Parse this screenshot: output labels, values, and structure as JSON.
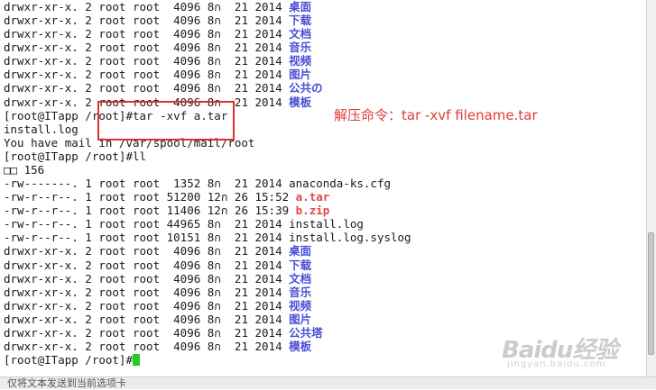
{
  "terminal": {
    "lines": [
      {
        "text": "drwxr-xr-x. 2 root root  4096 8ก  21 2014 ",
        "name": "桌面",
        "style": "dir"
      },
      {
        "text": "drwxr-xr-x. 2 root root  4096 8ก  21 2014 ",
        "name": "下载",
        "style": "dir"
      },
      {
        "text": "drwxr-xr-x. 2 root root  4096 8ก  21 2014 ",
        "name": "文档",
        "style": "dir"
      },
      {
        "text": "drwxr-xr-x. 2 root root  4096 8ก  21 2014 ",
        "name": "音乐",
        "style": "dir"
      },
      {
        "text": "drwxr-xr-x. 2 root root  4096 8ก  21 2014 ",
        "name": "视频",
        "style": "dir"
      },
      {
        "text": "drwxr-xr-x. 2 root root  4096 8ก  21 2014 ",
        "name": "图片",
        "style": "dir"
      },
      {
        "text": "drwxr-xr-x. 2 root root  4096 8ก  21 2014 ",
        "name": "公共の",
        "style": "dir"
      },
      {
        "text": "drwxr-xr-x. 2 root root  4096 8ก  21 2014 ",
        "name": "模板",
        "style": "dir"
      },
      {
        "text": "[root@ITapp /root]#tar -xvf a.tar",
        "name": "",
        "style": "plain"
      },
      {
        "text": "install.log",
        "name": "",
        "style": "plain"
      },
      {
        "text": "You have mail in /var/spool/mail/root",
        "name": "",
        "style": "plain"
      },
      {
        "text": "[root@ITapp /root]#ll",
        "name": "",
        "style": "plain"
      },
      {
        "text": "□□ 156",
        "name": "",
        "style": "plain"
      },
      {
        "text": "-rw-------. 1 root root  1352 8ก  21 2014 anaconda-ks.cfg",
        "name": "",
        "style": "plain"
      },
      {
        "text": "-rw-r--r--. 1 root root 51200 12ก 26 15:52 ",
        "name": "a.tar",
        "style": "red"
      },
      {
        "text": "-rw-r--r--. 1 root root 11406 12ก 26 15:39 ",
        "name": "b.zip",
        "style": "red"
      },
      {
        "text": "-rw-r--r--. 1 root root 44965 8ก  21 2014 install.log",
        "name": "",
        "style": "plain"
      },
      {
        "text": "-rw-r--r--. 1 root root 10151 8ก  21 2014 install.log.syslog",
        "name": "",
        "style": "plain"
      },
      {
        "text": "drwxr-xr-x. 2 root root  4096 8ก  21 2014 ",
        "name": "桌面",
        "style": "dir"
      },
      {
        "text": "drwxr-xr-x. 2 root root  4096 8ก  21 2014 ",
        "name": "下载",
        "style": "dir"
      },
      {
        "text": "drwxr-xr-x. 2 root root  4096 8ก  21 2014 ",
        "name": "文档",
        "style": "dir"
      },
      {
        "text": "drwxr-xr-x. 2 root root  4096 8ก  21 2014 ",
        "name": "音乐",
        "style": "dir"
      },
      {
        "text": "drwxr-xr-x. 2 root root  4096 8ก  21 2014 ",
        "name": "视频",
        "style": "dir"
      },
      {
        "text": "drwxr-xr-x. 2 root root  4096 8ก  21 2014 ",
        "name": "图片",
        "style": "dir"
      },
      {
        "text": "drwxr-xr-x. 2 root root  4096 8ก  21 2014 ",
        "name": "公共塔",
        "style": "dir"
      },
      {
        "text": "drwxr-xr-x. 2 root root  4096 8ก  21 2014 ",
        "name": "模板",
        "style": "dir"
      },
      {
        "text": "[root@ITapp /root]#",
        "name": "",
        "style": "prompt"
      }
    ]
  },
  "annotation": {
    "text": "解压命令：tar -xvf filename.tar",
    "color": "#e03a3a"
  },
  "watermark": {
    "logo": "Baidu经验",
    "sub": "jingyan.baidu.com"
  },
  "statusbar": {
    "text": "仅将文本发送到当前选项卡"
  },
  "colors": {
    "directory": "#4a4fd6",
    "archive": "#e04a4a",
    "cursor": "#22cc22"
  }
}
